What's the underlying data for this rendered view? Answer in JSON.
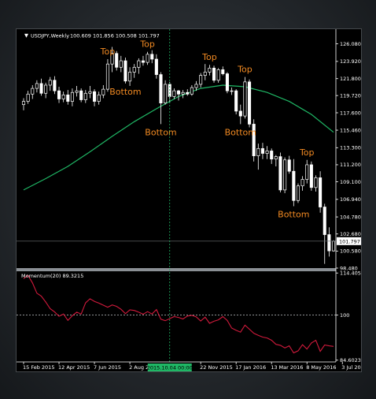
{
  "header": {
    "symbol_label": "USDJPY,Weekly",
    "ohlc": "100.609 101.856 100.508 101.797"
  },
  "colors": {
    "background": "#000000",
    "candle_up_fill": "#000000",
    "candle_down_fill": "#ffffff",
    "candle_outline": "#ffffff",
    "ma_line": "#1fb765",
    "momentum_line": "#d11a3c",
    "annotation": "#f28a22",
    "crosshair": "#1fb765",
    "grid_text": "#ffffff"
  },
  "chart_data": [
    {
      "type": "candlestick",
      "name": "price",
      "ylim": [
        98.48,
        127.5
      ],
      "y_ticks": [
        "126.080",
        "123.920",
        "121.800",
        "119.720",
        "117.600",
        "115.460",
        "113.300",
        "111.200",
        "109.100",
        "106.940",
        "104.780",
        "102.680",
        "100.580",
        "98.480"
      ],
      "last_price_label": "101.797",
      "candles": [
        {
          "o": 118.6,
          "h": 119.4,
          "l": 117.9,
          "c": 119.0
        },
        {
          "o": 119.0,
          "h": 120.3,
          "l": 118.7,
          "c": 119.9
        },
        {
          "o": 119.9,
          "h": 121.0,
          "l": 119.3,
          "c": 120.6
        },
        {
          "o": 120.6,
          "h": 121.6,
          "l": 120.1,
          "c": 121.2
        },
        {
          "o": 121.2,
          "h": 121.8,
          "l": 119.7,
          "c": 120.0
        },
        {
          "o": 120.0,
          "h": 121.3,
          "l": 119.4,
          "c": 121.0
        },
        {
          "o": 121.0,
          "h": 122.0,
          "l": 120.3,
          "c": 121.6
        },
        {
          "o": 121.6,
          "h": 122.1,
          "l": 119.9,
          "c": 120.3
        },
        {
          "o": 120.3,
          "h": 120.8,
          "l": 118.8,
          "c": 119.3
        },
        {
          "o": 119.3,
          "h": 120.2,
          "l": 118.9,
          "c": 119.8
        },
        {
          "o": 119.8,
          "h": 120.4,
          "l": 118.6,
          "c": 119.0
        },
        {
          "o": 119.0,
          "h": 120.6,
          "l": 118.4,
          "c": 120.1
        },
        {
          "o": 120.1,
          "h": 120.9,
          "l": 119.6,
          "c": 120.3
        },
        {
          "o": 120.3,
          "h": 120.6,
          "l": 118.9,
          "c": 119.2
        },
        {
          "o": 119.2,
          "h": 120.4,
          "l": 118.8,
          "c": 120.0
        },
        {
          "o": 120.0,
          "h": 120.9,
          "l": 119.4,
          "c": 120.2
        },
        {
          "o": 120.2,
          "h": 120.5,
          "l": 118.4,
          "c": 119.0
        },
        {
          "o": 119.0,
          "h": 120.2,
          "l": 118.6,
          "c": 119.8
        },
        {
          "o": 119.8,
          "h": 121.0,
          "l": 119.4,
          "c": 120.5
        },
        {
          "o": 120.5,
          "h": 124.2,
          "l": 120.2,
          "c": 123.6
        },
        {
          "o": 123.6,
          "h": 125.7,
          "l": 122.6,
          "c": 124.9
        },
        {
          "o": 124.9,
          "h": 125.2,
          "l": 122.8,
          "c": 123.2
        },
        {
          "o": 123.2,
          "h": 124.6,
          "l": 122.6,
          "c": 124.0
        },
        {
          "o": 124.0,
          "h": 124.4,
          "l": 121.2,
          "c": 121.5
        },
        {
          "o": 121.5,
          "h": 123.2,
          "l": 120.9,
          "c": 122.6
        },
        {
          "o": 122.6,
          "h": 123.6,
          "l": 121.9,
          "c": 123.2
        },
        {
          "o": 123.2,
          "h": 124.3,
          "l": 122.4,
          "c": 124.0
        },
        {
          "o": 124.0,
          "h": 124.6,
          "l": 123.4,
          "c": 123.8
        },
        {
          "o": 123.8,
          "h": 125.1,
          "l": 123.5,
          "c": 124.8
        },
        {
          "o": 124.8,
          "h": 125.3,
          "l": 123.7,
          "c": 124.2
        },
        {
          "o": 124.2,
          "h": 124.8,
          "l": 121.8,
          "c": 122.3
        },
        {
          "o": 122.3,
          "h": 122.6,
          "l": 116.2,
          "c": 118.8
        },
        {
          "o": 118.8,
          "h": 121.6,
          "l": 118.6,
          "c": 121.1
        },
        {
          "o": 121.1,
          "h": 121.4,
          "l": 118.8,
          "c": 119.6
        },
        {
          "o": 119.6,
          "h": 120.6,
          "l": 119.3,
          "c": 120.3
        },
        {
          "o": 120.3,
          "h": 120.4,
          "l": 119.1,
          "c": 119.9
        },
        {
          "o": 119.9,
          "h": 120.4,
          "l": 119.4,
          "c": 120.1
        },
        {
          "o": 120.1,
          "h": 120.5,
          "l": 119.7,
          "c": 119.9
        },
        {
          "o": 119.9,
          "h": 121.0,
          "l": 119.7,
          "c": 120.7
        },
        {
          "o": 120.7,
          "h": 121.5,
          "l": 120.3,
          "c": 121.1
        },
        {
          "o": 121.1,
          "h": 122.5,
          "l": 120.7,
          "c": 122.2
        },
        {
          "o": 122.2,
          "h": 123.6,
          "l": 121.6,
          "c": 122.6
        },
        {
          "o": 122.6,
          "h": 123.5,
          "l": 122.2,
          "c": 123.1
        },
        {
          "o": 123.1,
          "h": 123.4,
          "l": 121.3,
          "c": 121.6
        },
        {
          "o": 121.6,
          "h": 123.1,
          "l": 121.3,
          "c": 122.9
        },
        {
          "o": 122.9,
          "h": 123.3,
          "l": 122.2,
          "c": 122.4
        },
        {
          "o": 122.4,
          "h": 122.6,
          "l": 120.0,
          "c": 120.3
        },
        {
          "o": 120.3,
          "h": 120.7,
          "l": 119.8,
          "c": 120.3
        },
        {
          "o": 120.3,
          "h": 120.5,
          "l": 117.4,
          "c": 117.8
        },
        {
          "o": 117.8,
          "h": 118.6,
          "l": 116.2,
          "c": 117.2
        },
        {
          "o": 117.2,
          "h": 122.0,
          "l": 116.9,
          "c": 121.4
        },
        {
          "o": 121.4,
          "h": 121.7,
          "l": 115.8,
          "c": 116.2
        },
        {
          "o": 116.2,
          "h": 116.8,
          "l": 111.6,
          "c": 112.3
        },
        {
          "o": 112.3,
          "h": 113.8,
          "l": 110.6,
          "c": 113.2
        },
        {
          "o": 113.2,
          "h": 113.9,
          "l": 111.9,
          "c": 112.6
        },
        {
          "o": 112.6,
          "h": 113.5,
          "l": 111.9,
          "c": 112.9
        },
        {
          "o": 112.9,
          "h": 113.2,
          "l": 111.3,
          "c": 111.9
        },
        {
          "o": 111.9,
          "h": 112.4,
          "l": 111.0,
          "c": 112.2
        },
        {
          "o": 112.2,
          "h": 112.7,
          "l": 107.8,
          "c": 108.1
        },
        {
          "o": 108.1,
          "h": 112.1,
          "l": 107.7,
          "c": 111.8
        },
        {
          "o": 111.8,
          "h": 112.3,
          "l": 110.1,
          "c": 110.4
        },
        {
          "o": 110.4,
          "h": 111.9,
          "l": 106.1,
          "c": 106.8
        },
        {
          "o": 106.8,
          "h": 108.9,
          "l": 106.5,
          "c": 108.6
        },
        {
          "o": 108.6,
          "h": 109.8,
          "l": 108.0,
          "c": 109.4
        },
        {
          "o": 109.4,
          "h": 111.8,
          "l": 108.9,
          "c": 111.2
        },
        {
          "o": 111.2,
          "h": 111.6,
          "l": 108.0,
          "c": 108.4
        },
        {
          "o": 108.4,
          "h": 109.9,
          "l": 107.9,
          "c": 109.6
        },
        {
          "o": 109.6,
          "h": 110.4,
          "l": 105.3,
          "c": 106.0
        },
        {
          "o": 106.0,
          "h": 106.4,
          "l": 99.0,
          "c": 102.6
        },
        {
          "o": 102.6,
          "h": 103.5,
          "l": 99.9,
          "c": 100.6
        },
        {
          "o": 100.6,
          "h": 101.9,
          "l": 100.5,
          "c": 101.8
        }
      ],
      "moving_average": {
        "name": "",
        "points": [
          [
            0,
            108.1
          ],
          [
            5,
            109.5
          ],
          [
            10,
            111.0
          ],
          [
            15,
            112.8
          ],
          [
            20,
            114.7
          ],
          [
            25,
            116.5
          ],
          [
            30,
            118.1
          ],
          [
            35,
            119.6
          ],
          [
            40,
            120.6
          ],
          [
            45,
            121.0
          ],
          [
            50,
            120.8
          ],
          [
            55,
            120.1
          ],
          [
            60,
            119.0
          ],
          [
            65,
            117.4
          ],
          [
            70,
            115.2
          ]
        ]
      },
      "annotations": [
        {
          "text": "Top",
          "index": 19,
          "kind": "top"
        },
        {
          "text": "Top",
          "index": 28,
          "kind": "top"
        },
        {
          "text": "Bottom",
          "index": 23,
          "kind": "bottom"
        },
        {
          "text": "Bottom",
          "index": 31,
          "kind": "bottom"
        },
        {
          "text": "Top",
          "index": 42,
          "kind": "top"
        },
        {
          "text": "Top",
          "index": 50,
          "kind": "top"
        },
        {
          "text": "Bottom",
          "index": 49,
          "kind": "bottom"
        },
        {
          "text": "Top",
          "index": 64,
          "kind": "top"
        },
        {
          "text": "Bottom",
          "index": 61,
          "kind": "bottom"
        }
      ]
    },
    {
      "type": "line",
      "name": "momentum",
      "label": "Momentum(20) 89.3215",
      "ylim": [
        84.0,
        115.0
      ],
      "y_ticks": [
        "114.4051",
        "100",
        "84.6023"
      ],
      "reference_level": 100,
      "values": [
        112.5,
        113.6,
        111.0,
        107.5,
        106.5,
        104.5,
        102.2,
        101.1,
        99.6,
        100.4,
        98.2,
        99.8,
        101.0,
        100.4,
        104.2,
        105.6,
        104.7,
        104.1,
        103.4,
        102.7,
        103.5,
        103.0,
        102.0,
        100.5,
        101.8,
        101.6,
        101.0,
        100.3,
        101.2,
        100.4,
        101.9,
        98.6,
        98.1,
        98.8,
        99.5,
        99.2,
        98.7,
        99.7,
        99.9,
        99.4,
        98.0,
        99.3,
        97.2,
        97.9,
        98.4,
        99.5,
        98.2,
        95.6,
        94.8,
        94.2,
        96.6,
        95.2,
        93.8,
        93.1,
        92.5,
        92.2,
        91.4,
        90.0,
        89.7,
        88.8,
        89.5,
        87.1,
        87.8,
        89.9,
        88.4,
        90.5,
        91.4,
        87.6,
        89.8,
        89.5,
        89.3
      ]
    },
    {
      "type": "axis",
      "name": "time",
      "x_ticks": [
        {
          "label": "15 Feb 2015",
          "index": 0
        },
        {
          "label": "12 Apr 2015",
          "index": 8
        },
        {
          "label": "7 Jun 2015",
          "index": 16
        },
        {
          "label": "2 Aug 2015",
          "index": 24
        },
        {
          "label": "22 Nov 2015",
          "index": 40
        },
        {
          "label": "17 Jan 2016",
          "index": 48
        },
        {
          "label": "13 Mar 2016",
          "index": 56
        },
        {
          "label": "8 May 2016",
          "index": 64
        },
        {
          "label": "3 Jul 2016",
          "index": 72
        }
      ],
      "crosshair": {
        "label": "2015.10.04 00:00",
        "index": 33
      }
    }
  ]
}
